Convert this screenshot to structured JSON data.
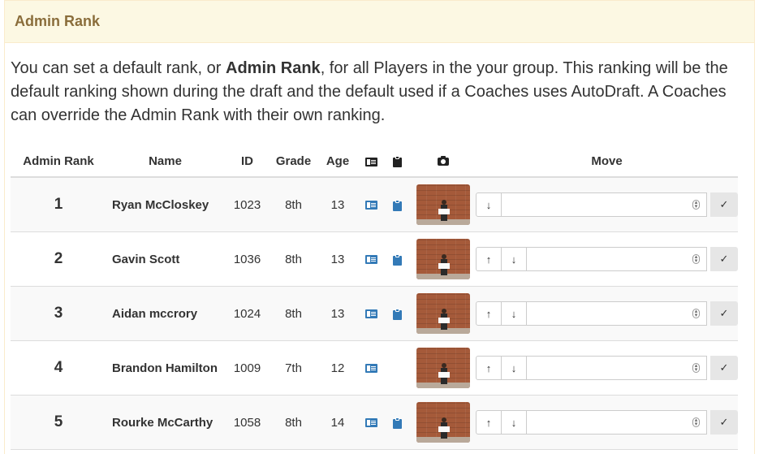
{
  "panel": {
    "title": "Admin Rank"
  },
  "intro": {
    "before": "You can set a default rank, or ",
    "bold": "Admin Rank",
    "after": ", for all Players in the your group. This ranking will be the default ranking shown during the draft and the default used if a Coaches uses AutoDraft. A Coaches can override the Admin Rank with their own ranking."
  },
  "table": {
    "headers": {
      "rank": "Admin Rank",
      "name": "Name",
      "id": "ID",
      "grade": "Grade",
      "age": "Age",
      "card_icon": "id-card-icon",
      "clip_icon": "clipboard-icon",
      "photo_icon": "camera-icon",
      "move": "Move"
    },
    "rows": [
      {
        "rank": "1",
        "name": "Ryan McCloskey",
        "id": "1023",
        "grade": "8th",
        "age": "13",
        "has_card": true,
        "has_clip": true,
        "up": false,
        "down": true
      },
      {
        "rank": "2",
        "name": "Gavin Scott",
        "id": "1036",
        "grade": "8th",
        "age": "13",
        "has_card": true,
        "has_clip": true,
        "up": true,
        "down": true
      },
      {
        "rank": "3",
        "name": "Aidan mccrory",
        "id": "1024",
        "grade": "8th",
        "age": "13",
        "has_card": true,
        "has_clip": true,
        "up": true,
        "down": true
      },
      {
        "rank": "4",
        "name": "Brandon Hamilton",
        "id": "1009",
        "grade": "7th",
        "age": "12",
        "has_card": true,
        "has_clip": false,
        "up": true,
        "down": true
      },
      {
        "rank": "5",
        "name": "Rourke McCarthy",
        "id": "1058",
        "grade": "8th",
        "age": "14",
        "has_card": true,
        "has_clip": true,
        "up": true,
        "down": true
      }
    ],
    "move_controls": {
      "up_glyph": "↑",
      "down_glyph": "↓",
      "confirm_glyph": "✓",
      "select_value": ""
    }
  },
  "colors": {
    "heading_bg": "#fcf8e3",
    "heading_text": "#8a6d3b",
    "icon_blue": "#337ab7",
    "row_stripe": "#f9f9f9"
  }
}
